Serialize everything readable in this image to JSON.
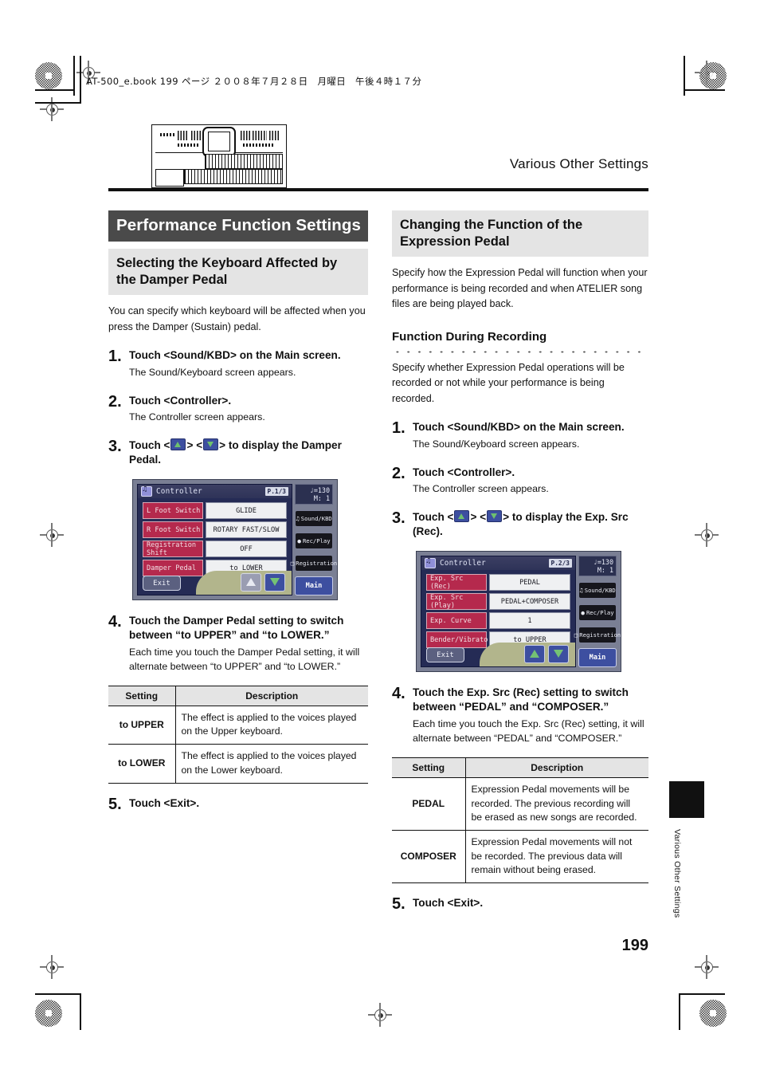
{
  "slug": "AT-500_e.book  199 ページ  ２００８年７月２８日　月曜日　午後４時１７分",
  "header": {
    "running_title": "Various Other Settings",
    "illustration": "organ-illustration"
  },
  "left": {
    "section_title": "Performance Function Settings",
    "subsection_title": "Selecting the Keyboard Affected by the Damper Pedal",
    "intro": "You can specify which keyboard will be affected when you press the Damper (Sustain) pedal.",
    "steps": [
      {
        "num": "1.",
        "head": "Touch <Sound/KBD> on the Main screen.",
        "sub": "The Sound/Keyboard screen appears."
      },
      {
        "num": "2.",
        "head": "Touch <Controller>.",
        "sub": "The Controller screen appears."
      },
      {
        "num": "3.",
        "head_pre": "Touch <",
        "head_mid": "> <",
        "head_post": "> to display the Damper Pedal."
      },
      {
        "num": "4.",
        "head": "Touch the Damper Pedal setting to switch between “to UPPER” and “to LOWER.”",
        "sub": "Each time you touch the Damper Pedal setting, it will alternate between “to UPPER” and “to LOWER.”"
      },
      {
        "num": "5.",
        "head": "Touch <Exit>."
      }
    ],
    "lcd": {
      "title": "Controller",
      "page_indicator": "P.1/3",
      "rows": [
        {
          "label": "L Foot Switch",
          "value": "GLIDE"
        },
        {
          "label": "R Foot Switch",
          "value": "ROTARY FAST/SLOW"
        },
        {
          "label": "Registration Shift",
          "value": "OFF"
        },
        {
          "label": "Damper Pedal",
          "value": "to LOWER"
        }
      ],
      "exit_label": "Exit",
      "up_enabled": false,
      "down_enabled": true,
      "tempo_note": "♩=130",
      "tempo_measure": "M:     1",
      "side_buttons": [
        "Sound/KBD",
        "Rec/Play",
        "Registration"
      ],
      "main_label": "Main"
    },
    "table": {
      "headers": [
        "Setting",
        "Description"
      ],
      "rows": [
        {
          "setting": "to UPPER",
          "description": "The effect is applied to the voices played on the Upper keyboard."
        },
        {
          "setting": "to LOWER",
          "description": "The effect is applied to the voices played on the Lower keyboard."
        }
      ]
    }
  },
  "right": {
    "subsection_title": "Changing the Function of the Expression Pedal",
    "intro": "Specify how the Expression Pedal will function when your performance is being recorded and when ATELIER song files are being played back.",
    "heading3": "Function During Recording",
    "intro2": "Specify whether Expression Pedal operations will be recorded or not while your performance is being recorded.",
    "steps": [
      {
        "num": "1.",
        "head": "Touch <Sound/KBD> on the Main screen.",
        "sub": "The Sound/Keyboard screen appears."
      },
      {
        "num": "2.",
        "head": "Touch <Controller>.",
        "sub": "The Controller screen appears."
      },
      {
        "num": "3.",
        "head_pre": "Touch <",
        "head_mid": "> <",
        "head_post": "> to display the Exp. Src (Rec)."
      },
      {
        "num": "4.",
        "head": "Touch the Exp. Src (Rec) setting to switch between “PEDAL” and “COMPOSER.”",
        "sub": "Each time you touch the Exp. Src (Rec) setting, it will alternate between “PEDAL” and “COMPOSER.”"
      },
      {
        "num": "5.",
        "head": "Touch <Exit>."
      }
    ],
    "lcd": {
      "title": "Controller",
      "page_indicator": "P.2/3",
      "rows": [
        {
          "label": "Exp. Src (Rec)",
          "value": "PEDAL"
        },
        {
          "label": "Exp. Src (Play)",
          "value": "PEDAL+COMPOSER"
        },
        {
          "label": "Exp. Curve",
          "value": "1"
        },
        {
          "label": "Bender/Vibrato",
          "value": "to UPPER"
        }
      ],
      "exit_label": "Exit",
      "up_enabled": true,
      "down_enabled": true,
      "tempo_note": "♩=130",
      "tempo_measure": "M:     1",
      "side_buttons": [
        "Sound/KBD",
        "Rec/Play",
        "Registration"
      ],
      "main_label": "Main"
    },
    "table": {
      "headers": [
        "Setting",
        "Description"
      ],
      "rows": [
        {
          "setting": "PEDAL",
          "description": "Expression Pedal movements will be recorded. The previous recording will be erased as new songs are recorded."
        },
        {
          "setting": "COMPOSER",
          "description": "Expression Pedal movements will not be recorded. The previous data will remain without being erased."
        }
      ]
    }
  },
  "footer": {
    "page_number": "199",
    "side_tab_label": "Various Other Settings"
  }
}
